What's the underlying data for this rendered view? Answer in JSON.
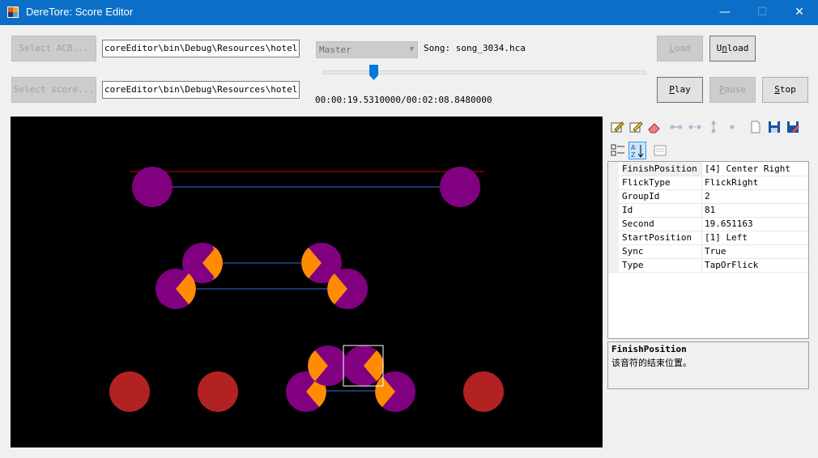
{
  "window": {
    "title": "DereTore: Score Editor",
    "minimize_glyph": "—",
    "maximize_glyph": "☐",
    "close_glyph": "✕"
  },
  "controls": {
    "select_acb_label": "Select ACB...",
    "select_score_label": "Select score...",
    "acb_path": "coreEditor\\bin\\Debug\\Resources\\hotel.acb",
    "score_path": "coreEditor\\bin\\Debug\\Resources\\hotel.bdb",
    "difficulty": "Master",
    "song_label": "Song: song_3034.hca",
    "time_display": "00:00:19.5310000/00:02:08.8480000",
    "load_label": "Load",
    "unload_label": "Unload",
    "play_label": "Play",
    "pause_label": "Pause",
    "stop_label": "Stop"
  },
  "playback": {
    "position_fraction": 0.152
  },
  "toolbar_icons": [
    "edit-note-icon",
    "edit-note-alt-icon",
    "eraser-icon",
    "connect-notes-icon",
    "disconnect-notes-icon",
    "vertical-connect-icon",
    "dot-icon",
    "new-file-icon",
    "save-icon",
    "save-as-icon"
  ],
  "grid_toolbar_icons": [
    "categorized-icon",
    "alphabetical-icon",
    "property-pages-icon"
  ],
  "properties": [
    {
      "name": "FinishPosition",
      "value": "[4] Center Right"
    },
    {
      "name": "FlickType",
      "value": "FlickRight"
    },
    {
      "name": "GroupId",
      "value": "2"
    },
    {
      "name": "Id",
      "value": "81"
    },
    {
      "name": "Second",
      "value": "19.651163"
    },
    {
      "name": "StartPosition",
      "value": "[1] Left"
    },
    {
      "name": "Sync",
      "value": "True"
    },
    {
      "name": "Type",
      "value": "TapOrFlick"
    }
  ],
  "help": {
    "title": "FinishPosition",
    "description": "该音符的结束位置。"
  },
  "colors": {
    "note_tap": "#800080",
    "note_flick_marker": "#ff8c00",
    "note_avatar": "#b22222",
    "sync_line": "#4169e1",
    "current_time_line": "#d10000",
    "selection_box": "#ffffff"
  }
}
